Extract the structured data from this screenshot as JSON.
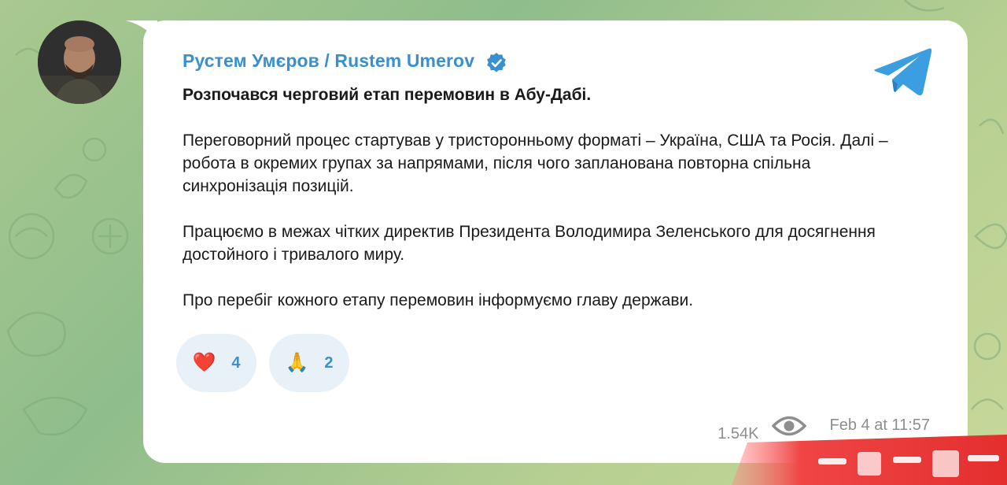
{
  "channel": {
    "sender_name": "Рустем Умєров / Rustem Umerov",
    "verified_icon": "verified-badge-icon",
    "logo_icon": "telegram-logo-icon"
  },
  "message": {
    "headline": "Розпочався черговий етап перемовин в Абу-Дабі.",
    "paragraph_1": "Переговорний процес стартував у тристоронньому форматі – Україна, США та Росія. Далі – робота в окремих групах за напрямами, після чого запланована повторна спільна синхронізація позицій.",
    "paragraph_2": "Працюємо в межах чітких директив Президента Володимира Зеленського для досягнення достойного і тривалого миру.",
    "paragraph_3": "Про перебіг кожного етапу перемовин інформуємо главу держави."
  },
  "reactions": [
    {
      "emoji": "❤️",
      "count": "4"
    },
    {
      "emoji": "🙏",
      "count": "2"
    }
  ],
  "meta": {
    "views": "1.54K",
    "timestamp": "Feb 4 at 11:57"
  },
  "colors": {
    "accent": "#3a8fcf",
    "bubble": "#ffffff",
    "reaction_bg": "#e8f1f8",
    "meta_text": "#8e8e8e"
  }
}
